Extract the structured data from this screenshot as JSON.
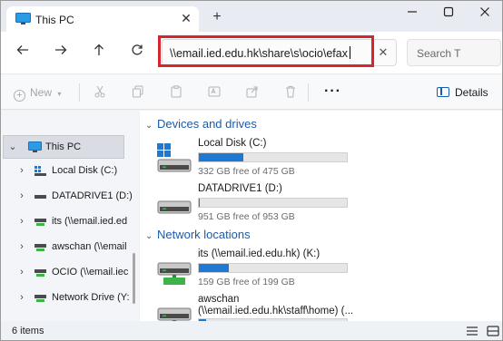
{
  "window": {
    "tab_title": "This PC",
    "new_tab_symbol": "+",
    "close_tab_symbol": "✕",
    "controls": [
      "minimize-icon",
      "maximize-icon",
      "close-icon"
    ]
  },
  "address_bar": {
    "value": "\\\\email.ied.edu.hk\\share\\s\\ocio\\efax",
    "clear_symbol": "✕"
  },
  "search": {
    "placeholder": "Search T"
  },
  "toolbar": {
    "new_label": "New",
    "more_label": "···",
    "details_label": "Details",
    "icons": [
      "cut-icon",
      "copy-icon",
      "paste-icon",
      "rename-icon",
      "share-icon",
      "delete-icon"
    ]
  },
  "nav_pane": {
    "items": [
      {
        "label": "This PC",
        "icon": "monitor-icon",
        "selected": true,
        "expanded": true
      },
      {
        "label": "Local Disk (C:)",
        "icon": "windows-drive-icon"
      },
      {
        "label": "DATADRIVE1 (D:)",
        "icon": "drive-icon"
      },
      {
        "label": "its (\\\\email.ied.ed",
        "icon": "network-drive-icon"
      },
      {
        "label": "awschan (\\\\email",
        "icon": "network-drive-icon"
      },
      {
        "label": "OCIO (\\\\email.iec",
        "icon": "network-drive-icon"
      },
      {
        "label": "Network Drive (Y:",
        "icon": "network-drive-icon"
      }
    ]
  },
  "main": {
    "sections": [
      {
        "title": "Devices and drives"
      },
      {
        "title": "Network locations"
      }
    ],
    "devices": [
      {
        "name": "Local Disk (C:)",
        "free": "332 GB free of 475 GB",
        "used_fraction": 0.3,
        "icon": "windows-drive-icon"
      },
      {
        "name": "DATADRIVE1 (D:)",
        "free": "951 GB free of 953 GB",
        "used_fraction": 0.002,
        "icon": "drive-icon"
      }
    ],
    "network": [
      {
        "name": "its (\\\\email.ied.edu.hk) (K:)",
        "free": "159 GB free of 199 GB",
        "used_fraction": 0.2,
        "icon": "network-drive-icon"
      },
      {
        "name": "awschan",
        "name2": "(\\\\email.ied.edu.hk\\staff\\home) (...",
        "used_fraction": 0.05,
        "icon": "network-drive-icon"
      }
    ]
  },
  "status": {
    "item_count": "6 items",
    "view_icons": [
      "details-view-icon",
      "tiles-view-icon"
    ]
  },
  "colors": {
    "accent": "#1f78d1",
    "highlight_box": "#d5252d",
    "section_title": "#1d5aa8"
  }
}
